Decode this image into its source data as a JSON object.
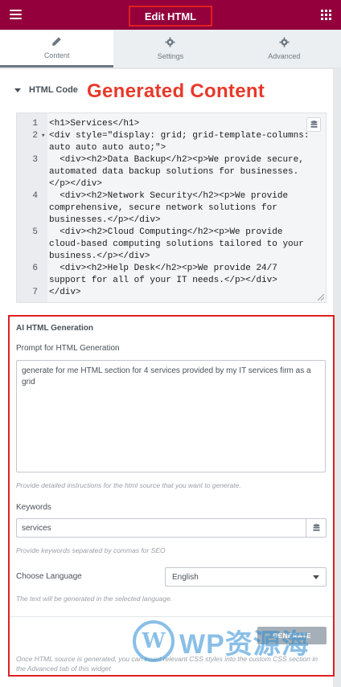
{
  "header": {
    "title": "Edit HTML",
    "menu_icon": "hamburger-menu-icon",
    "apps_icon": "grid-apps-icon",
    "bg_color": "#93003c"
  },
  "tabs": [
    {
      "label": "Content",
      "icon": "pencil-icon",
      "active": true
    },
    {
      "label": "Settings",
      "icon": "gear-icon",
      "active": false
    },
    {
      "label": "Advanced",
      "icon": "gear-icon",
      "active": false
    }
  ],
  "section": {
    "title": "HTML Code",
    "annotation": "Generated Content"
  },
  "editor": {
    "lines": [
      {
        "num": "1",
        "text": "<h1>Services</h1>"
      },
      {
        "num": "2",
        "text": "<div style=\"display: grid; grid-template-columns: auto auto auto auto;\">"
      },
      {
        "num": "3",
        "text": "  <div><h2>Data Backup</h2><p>We provide secure, automated data backup solutions for businesses.</p></div>"
      },
      {
        "num": "4",
        "text": "  <div><h2>Network Security</h2><p>We provide comprehensive, secure network solutions for businesses.</p></div>"
      },
      {
        "num": "5",
        "text": "  <div><h2>Cloud Computing</h2><p>We provide cloud-based computing solutions tailored to your business.</p></div>"
      },
      {
        "num": "6",
        "text": "  <div><h2>Help Desk</h2><p>We provide 24/7 support for all of your IT needs.</p></div>"
      },
      {
        "num": "7",
        "text": "</div>"
      }
    ]
  },
  "ai": {
    "heading": "AI HTML Generation",
    "prompt_label": "Prompt for HTML Generation",
    "prompt_value": "generate for me HTML section for 4 services  provided by my IT services firm as a grid",
    "prompt_hint": "Provide detailed instructions for the html source that you want to generate.",
    "keywords_label": "Keywords",
    "keywords_value": "services",
    "keywords_hint": "Provide keywords separated by commas for SEO",
    "language_label": "Choose Language",
    "language_value": "English",
    "language_hint": "The text will be generated in the selected language.",
    "generate_label": "GENERATE",
    "footer_note": "Once HTML source is generated, you can insert relevant CSS styles into the custom CSS section in the Advanced tab of this widget"
  },
  "watermark": {
    "logo": "W",
    "text": "WP资源海"
  }
}
